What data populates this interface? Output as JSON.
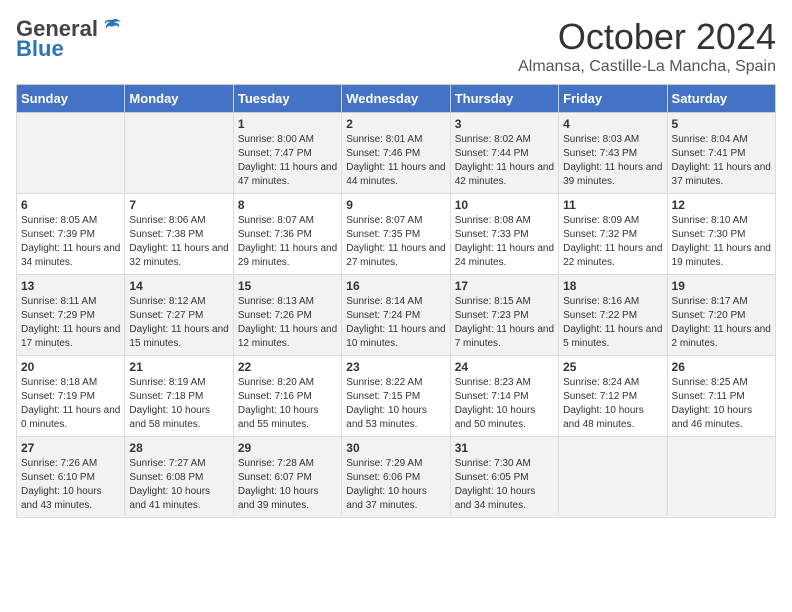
{
  "header": {
    "logo_general": "General",
    "logo_blue": "Blue",
    "month": "October 2024",
    "location": "Almansa, Castille-La Mancha, Spain"
  },
  "weekdays": [
    "Sunday",
    "Monday",
    "Tuesday",
    "Wednesday",
    "Thursday",
    "Friday",
    "Saturday"
  ],
  "weeks": [
    [
      {
        "day": "",
        "info": ""
      },
      {
        "day": "",
        "info": ""
      },
      {
        "day": "1",
        "info": "Sunrise: 8:00 AM\nSunset: 7:47 PM\nDaylight: 11 hours and 47 minutes."
      },
      {
        "day": "2",
        "info": "Sunrise: 8:01 AM\nSunset: 7:46 PM\nDaylight: 11 hours and 44 minutes."
      },
      {
        "day": "3",
        "info": "Sunrise: 8:02 AM\nSunset: 7:44 PM\nDaylight: 11 hours and 42 minutes."
      },
      {
        "day": "4",
        "info": "Sunrise: 8:03 AM\nSunset: 7:43 PM\nDaylight: 11 hours and 39 minutes."
      },
      {
        "day": "5",
        "info": "Sunrise: 8:04 AM\nSunset: 7:41 PM\nDaylight: 11 hours and 37 minutes."
      }
    ],
    [
      {
        "day": "6",
        "info": "Sunrise: 8:05 AM\nSunset: 7:39 PM\nDaylight: 11 hours and 34 minutes."
      },
      {
        "day": "7",
        "info": "Sunrise: 8:06 AM\nSunset: 7:38 PM\nDaylight: 11 hours and 32 minutes."
      },
      {
        "day": "8",
        "info": "Sunrise: 8:07 AM\nSunset: 7:36 PM\nDaylight: 11 hours and 29 minutes."
      },
      {
        "day": "9",
        "info": "Sunrise: 8:07 AM\nSunset: 7:35 PM\nDaylight: 11 hours and 27 minutes."
      },
      {
        "day": "10",
        "info": "Sunrise: 8:08 AM\nSunset: 7:33 PM\nDaylight: 11 hours and 24 minutes."
      },
      {
        "day": "11",
        "info": "Sunrise: 8:09 AM\nSunset: 7:32 PM\nDaylight: 11 hours and 22 minutes."
      },
      {
        "day": "12",
        "info": "Sunrise: 8:10 AM\nSunset: 7:30 PM\nDaylight: 11 hours and 19 minutes."
      }
    ],
    [
      {
        "day": "13",
        "info": "Sunrise: 8:11 AM\nSunset: 7:29 PM\nDaylight: 11 hours and 17 minutes."
      },
      {
        "day": "14",
        "info": "Sunrise: 8:12 AM\nSunset: 7:27 PM\nDaylight: 11 hours and 15 minutes."
      },
      {
        "day": "15",
        "info": "Sunrise: 8:13 AM\nSunset: 7:26 PM\nDaylight: 11 hours and 12 minutes."
      },
      {
        "day": "16",
        "info": "Sunrise: 8:14 AM\nSunset: 7:24 PM\nDaylight: 11 hours and 10 minutes."
      },
      {
        "day": "17",
        "info": "Sunrise: 8:15 AM\nSunset: 7:23 PM\nDaylight: 11 hours and 7 minutes."
      },
      {
        "day": "18",
        "info": "Sunrise: 8:16 AM\nSunset: 7:22 PM\nDaylight: 11 hours and 5 minutes."
      },
      {
        "day": "19",
        "info": "Sunrise: 8:17 AM\nSunset: 7:20 PM\nDaylight: 11 hours and 2 minutes."
      }
    ],
    [
      {
        "day": "20",
        "info": "Sunrise: 8:18 AM\nSunset: 7:19 PM\nDaylight: 11 hours and 0 minutes."
      },
      {
        "day": "21",
        "info": "Sunrise: 8:19 AM\nSunset: 7:18 PM\nDaylight: 10 hours and 58 minutes."
      },
      {
        "day": "22",
        "info": "Sunrise: 8:20 AM\nSunset: 7:16 PM\nDaylight: 10 hours and 55 minutes."
      },
      {
        "day": "23",
        "info": "Sunrise: 8:22 AM\nSunset: 7:15 PM\nDaylight: 10 hours and 53 minutes."
      },
      {
        "day": "24",
        "info": "Sunrise: 8:23 AM\nSunset: 7:14 PM\nDaylight: 10 hours and 50 minutes."
      },
      {
        "day": "25",
        "info": "Sunrise: 8:24 AM\nSunset: 7:12 PM\nDaylight: 10 hours and 48 minutes."
      },
      {
        "day": "26",
        "info": "Sunrise: 8:25 AM\nSunset: 7:11 PM\nDaylight: 10 hours and 46 minutes."
      }
    ],
    [
      {
        "day": "27",
        "info": "Sunrise: 7:26 AM\nSunset: 6:10 PM\nDaylight: 10 hours and 43 minutes."
      },
      {
        "day": "28",
        "info": "Sunrise: 7:27 AM\nSunset: 6:08 PM\nDaylight: 10 hours and 41 minutes."
      },
      {
        "day": "29",
        "info": "Sunrise: 7:28 AM\nSunset: 6:07 PM\nDaylight: 10 hours and 39 minutes."
      },
      {
        "day": "30",
        "info": "Sunrise: 7:29 AM\nSunset: 6:06 PM\nDaylight: 10 hours and 37 minutes."
      },
      {
        "day": "31",
        "info": "Sunrise: 7:30 AM\nSunset: 6:05 PM\nDaylight: 10 hours and 34 minutes."
      },
      {
        "day": "",
        "info": ""
      },
      {
        "day": "",
        "info": ""
      }
    ]
  ]
}
